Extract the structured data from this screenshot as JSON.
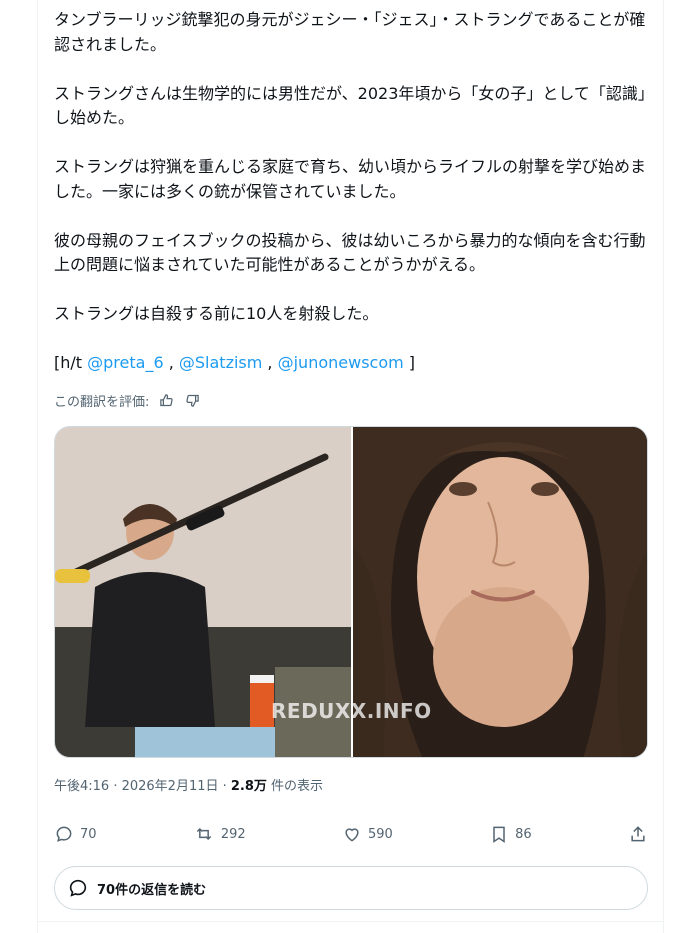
{
  "tweet": {
    "paragraphs": [
      "タンブラーリッジ銃撃犯の身元がジェシー・「ジェス」・ストラングであることが確認されました。",
      "ストラングさんは生物学的には男性だが、2023年頃から「女の子」として「認識」し始めた。",
      "ストラングは狩猟を重んじる家庭で育ち、幼い頃からライフルの射撃を学び始めました。一家には多くの銃が保管されていました。",
      "彼の母親のフェイスブックの投稿から、彼は幼いころから暴力的な傾向を含む行動上の問題に悩まされていた可能性があることがうかがえる。",
      "ストラングは自殺する前に10人を射殺した。"
    ],
    "ht_prefix": "[h/t ",
    "mentions": [
      "@preta_6",
      "@Slatzism",
      "@junonewscom"
    ],
    "separator": " , ",
    "ht_suffix": " ]",
    "translate_label": "この翻訳を評価:",
    "watermark": "REDUXX.INFO",
    "timestamp": "午後4:16 · 2026年2月11日 · ",
    "views_count": "2.8万",
    "views_label": " 件の表示"
  },
  "actions": {
    "replies": "70",
    "retweets": "292",
    "likes": "590",
    "bookmarks": "86"
  },
  "read_replies_label": "70件の返信を読む",
  "colors": {
    "accent": "#1d9bf0",
    "muted": "#536471",
    "text": "#0f1419"
  }
}
